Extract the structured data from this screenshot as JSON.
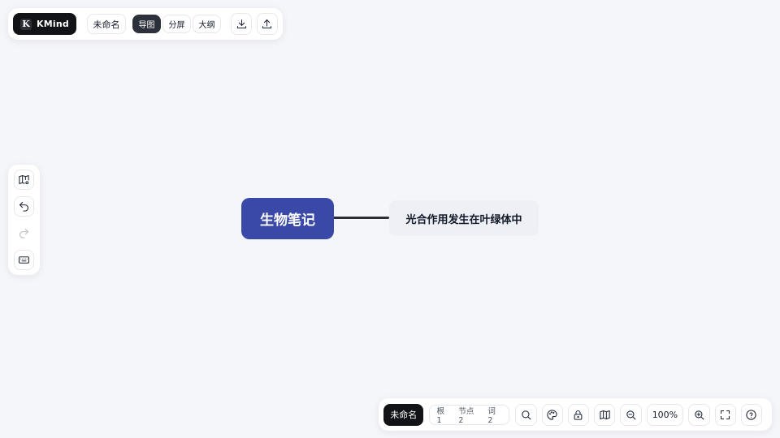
{
  "app": {
    "name": "KMind",
    "logo_letter": "K"
  },
  "top_bar": {
    "doc_name": "未命名",
    "views": [
      {
        "label": "导图",
        "active": true
      },
      {
        "label": "分屏",
        "active": false
      },
      {
        "label": "大纲",
        "active": false
      }
    ],
    "icons": [
      "download-icon",
      "upload-icon"
    ]
  },
  "left_bar": {
    "icons": [
      "map-settings-icon",
      "undo-icon",
      "redo-icon",
      "keyboard-icon"
    ]
  },
  "mindmap": {
    "root": {
      "label": "生物笔记",
      "color": "#3a48a8"
    },
    "children": [
      {
        "label": "光合作用发生在叶绿体中"
      }
    ]
  },
  "bottom_bar": {
    "doc_name": "未命名",
    "stats": {
      "root": "根 1",
      "nodes": "节点 2",
      "words": "词 2"
    },
    "zoom": "100%",
    "icons": [
      "search-icon",
      "palette-icon",
      "lock-icon",
      "map-icon",
      "zoom-out-icon",
      "zoom-in-icon",
      "fullscreen-icon",
      "help-icon"
    ]
  }
}
